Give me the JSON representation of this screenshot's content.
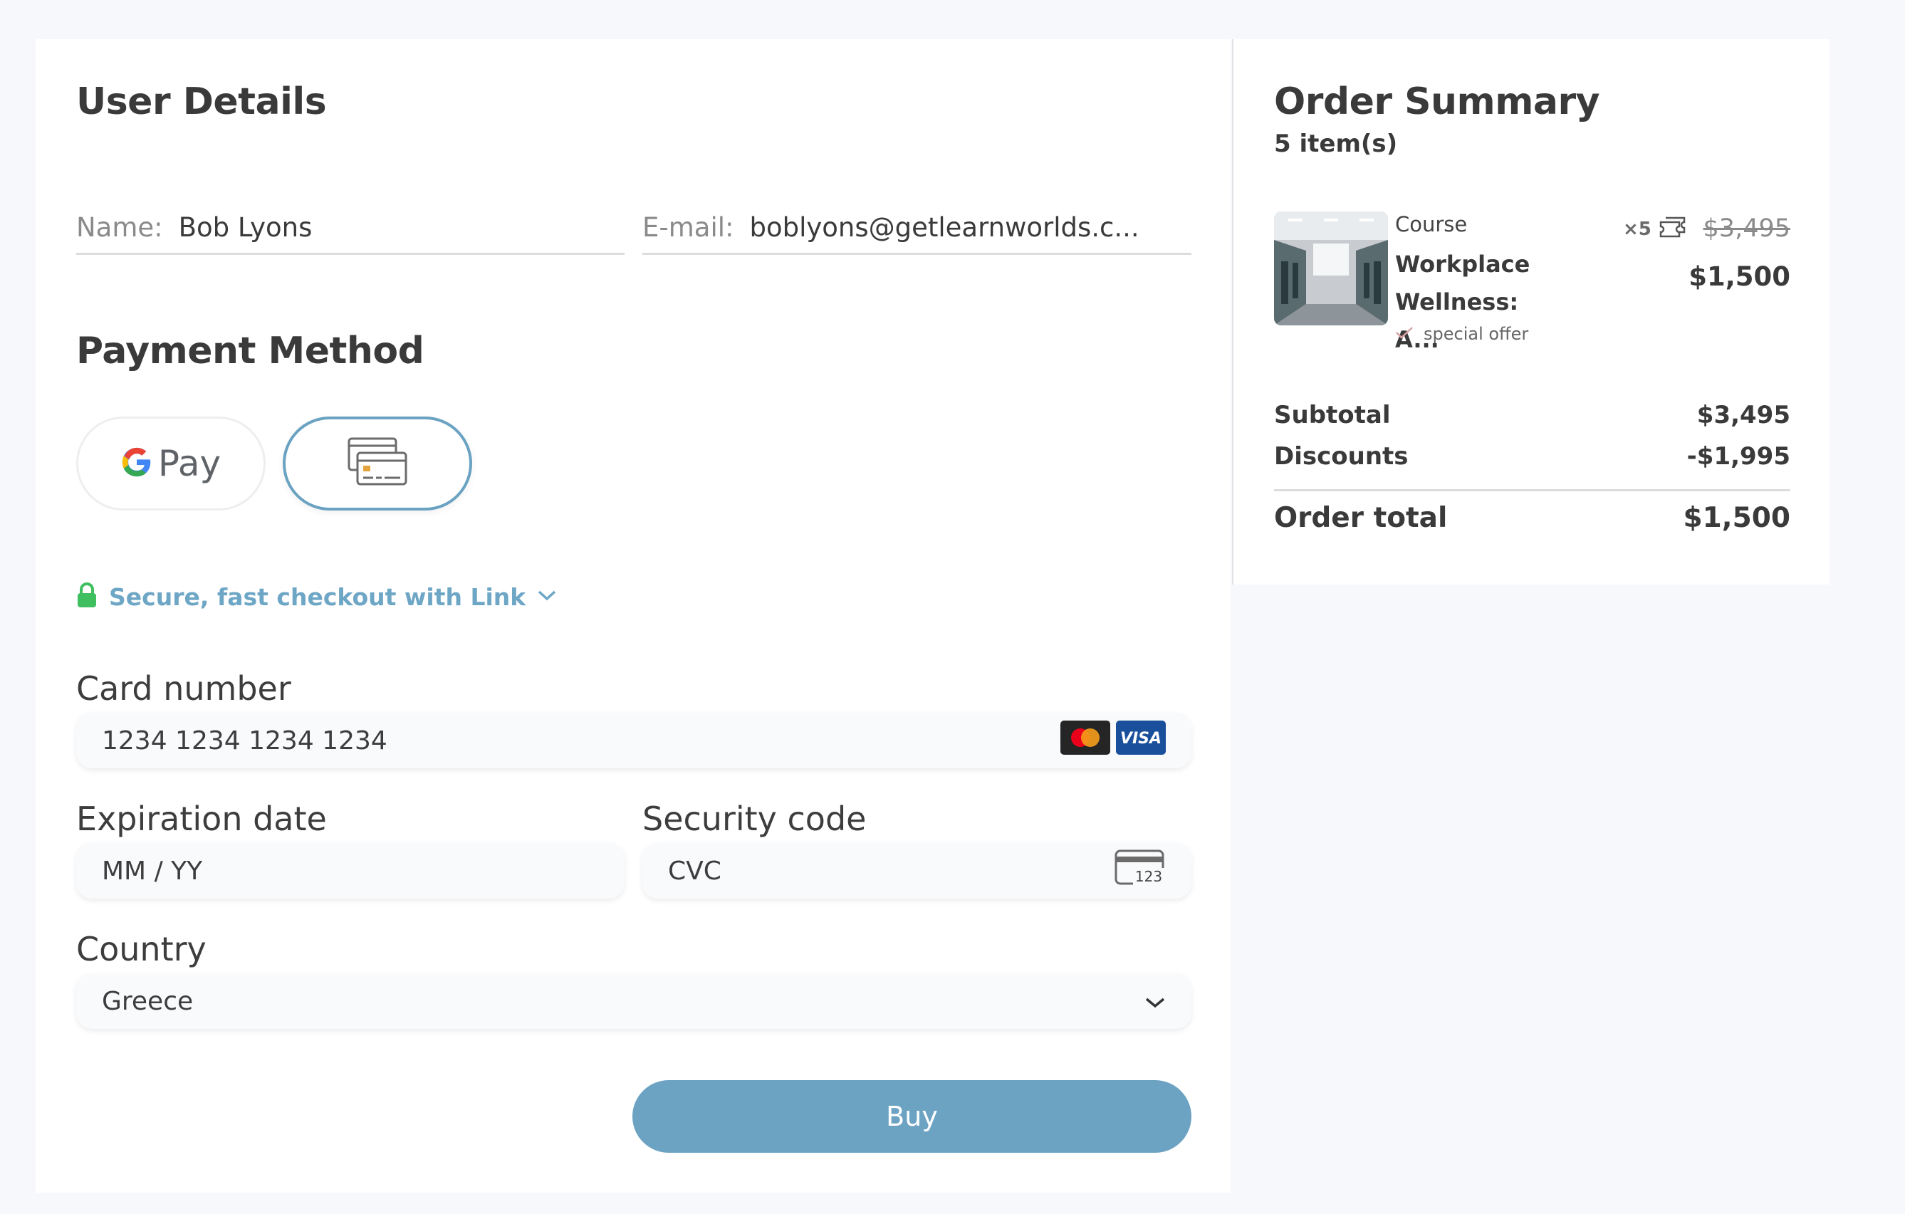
{
  "user_details": {
    "title": "User Details",
    "name_label": "Name:",
    "name_value": "Bob Lyons",
    "email_label": "E-mail:",
    "email_value": "boblyons@getlearnworlds.c..."
  },
  "payment": {
    "title": "Payment Method",
    "methods": [
      {
        "name": "Pay",
        "icon": "google-pay-icon",
        "selected": false
      },
      {
        "name": "card",
        "icon": "credit-card-icon",
        "selected": true
      }
    ],
    "link_text": "Secure, fast checkout with Link",
    "card_number_label": "Card number",
    "card_number_placeholder": "1234 1234 1234 1234",
    "card_brands": [
      "mastercard",
      "VISA"
    ],
    "expiration_label": "Expiration date",
    "expiration_placeholder": "MM / YY",
    "security_label": "Security code",
    "security_placeholder": "CVC",
    "cvc_icon_text": "123",
    "country_label": "Country",
    "country_value": "Greece",
    "buy_label": "Buy"
  },
  "order_summary": {
    "title": "Order Summary",
    "item_count": "5 item(s)",
    "item": {
      "type": "Course",
      "name_line1": "Workplace",
      "name_line2": "Wellness: A...",
      "special": "special offer",
      "quantity": "×5",
      "old_price": "$3,495",
      "new_price": "$1,500"
    },
    "subtotal_label": "Subtotal",
    "subtotal_value": "$3,495",
    "discounts_label": "Discounts",
    "discounts_value": "-$1,995",
    "total_label": "Order total",
    "total_value": "$1,500"
  },
  "colors": {
    "accent": "#6ca3c3",
    "link": "#6ea6c5",
    "lock": "#3fbf5f",
    "background": "#f7f8fb"
  }
}
